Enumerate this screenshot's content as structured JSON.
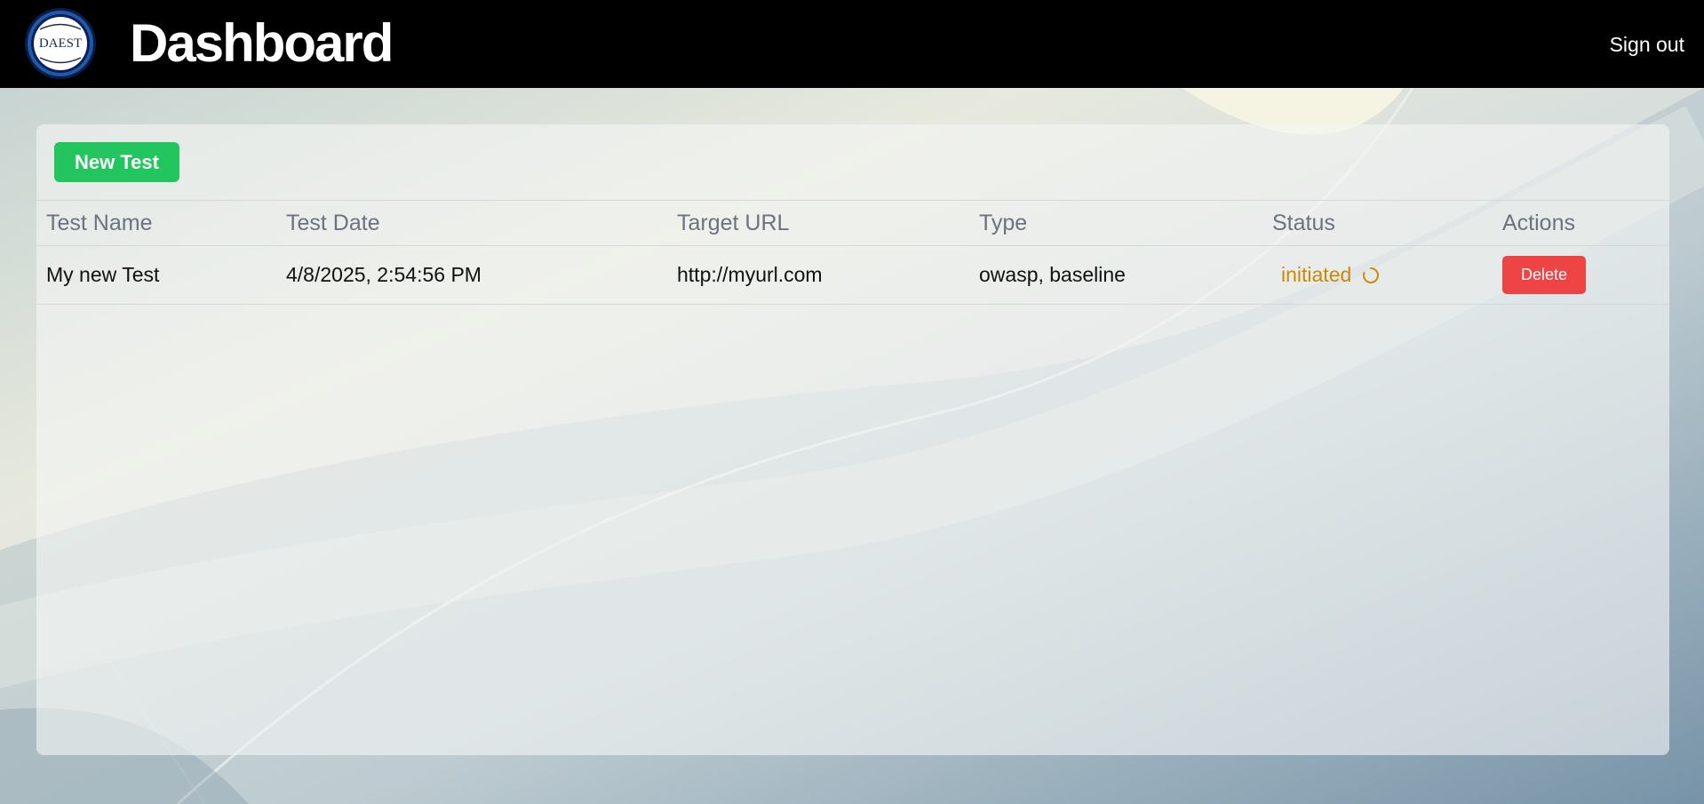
{
  "header": {
    "logo_text": "DAEST",
    "title": "Dashboard",
    "sign_out_label": "Sign out"
  },
  "toolbar": {
    "new_test_label": "New Test"
  },
  "table": {
    "columns": [
      "Test Name",
      "Test Date",
      "Target URL",
      "Type",
      "Status",
      "Actions"
    ],
    "rows": [
      {
        "name": "My new Test",
        "date": "4/8/2025, 2:54:56 PM",
        "target_url": "http://myurl.com",
        "type": "owasp, baseline",
        "status": "initiated",
        "action_label": "Delete"
      }
    ]
  },
  "colors": {
    "header_bg": "#000000",
    "new_test_button": "#22c55e",
    "delete_button": "#ef4444",
    "status_initiated": "#ca8a04",
    "header_text": "#6b7280"
  },
  "icons": {
    "status_spinner": "spinner-icon",
    "logo": "daest-logo"
  }
}
